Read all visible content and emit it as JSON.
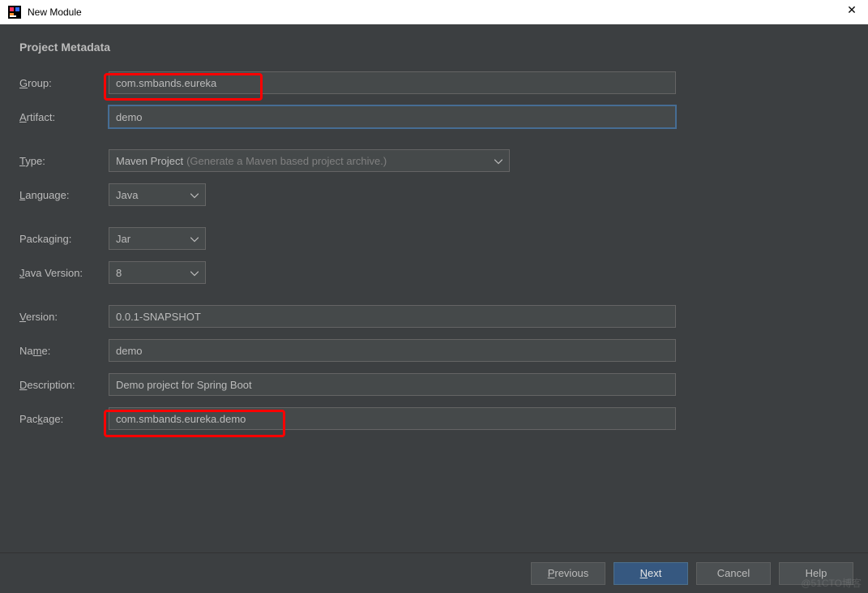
{
  "window": {
    "title": "New Module"
  },
  "section": {
    "title": "Project Metadata"
  },
  "labels": {
    "group": "Group:",
    "artifact": "Artifact:",
    "type": "Type:",
    "language": "Language:",
    "packaging": "Packaging:",
    "javaVersion": "Java Version:",
    "version": "Version:",
    "name": "Name:",
    "description": "Description:",
    "package": "Package:"
  },
  "mnemonics": {
    "group": "G",
    "artifact": "A",
    "type": "T",
    "language": "L",
    "javaVersion": "J",
    "version": "V",
    "name": "m",
    "description": "D",
    "package": "k"
  },
  "values": {
    "group": "com.smbands.eureka",
    "artifact": "demo",
    "type": "Maven Project",
    "typeHint": "(Generate a Maven based project archive.)",
    "language": "Java",
    "packaging": "Jar",
    "javaVersion": "8",
    "version": "0.0.1-SNAPSHOT",
    "name": "demo",
    "description": "Demo project for Spring Boot",
    "package": "com.smbands.eureka.demo"
  },
  "buttons": {
    "previous": "Previous",
    "next": "Next",
    "cancel": "Cancel",
    "help": "Help"
  },
  "watermark": "@51CTO博客"
}
